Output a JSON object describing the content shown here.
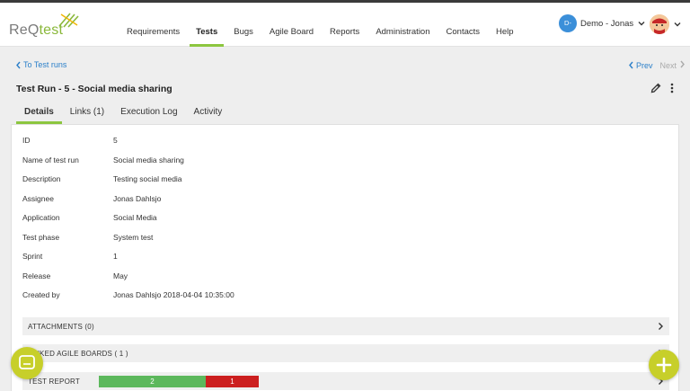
{
  "app": {
    "logo_main": "ReQ",
    "logo_accent": "test"
  },
  "nav": [
    {
      "label": "Requirements",
      "active": false
    },
    {
      "label": "Tests",
      "active": true
    },
    {
      "label": "Bugs",
      "active": false
    },
    {
      "label": "Agile Board",
      "active": false
    },
    {
      "label": "Reports",
      "active": false
    },
    {
      "label": "Administration",
      "active": false
    },
    {
      "label": "Contacts",
      "active": false
    },
    {
      "label": "Help",
      "active": false
    }
  ],
  "user": {
    "initials": "D-",
    "name": "Demo - Jonas"
  },
  "breadcrumb": {
    "back": "To Test runs",
    "prev": "Prev",
    "next": "Next"
  },
  "page": {
    "title": "Test Run - 5 - Social media sharing"
  },
  "tabs": [
    {
      "label": "Details",
      "active": true
    },
    {
      "label": "Links (1)",
      "active": false
    },
    {
      "label": "Execution Log",
      "active": false
    },
    {
      "label": "Activity",
      "active": false
    }
  ],
  "fields": [
    {
      "label": "ID",
      "value": "5"
    },
    {
      "label": "Name of test run",
      "value": "Social media sharing"
    },
    {
      "label": "Description",
      "value": "Testing social media"
    },
    {
      "label": "Assignee",
      "value": "Jonas Dahlsjo"
    },
    {
      "label": "Application",
      "value": "Social Media"
    },
    {
      "label": "Test phase",
      "value": "System test"
    },
    {
      "label": "Sprint",
      "value": "1"
    },
    {
      "label": "Release",
      "value": "May"
    },
    {
      "label": "Created by",
      "value": "Jonas Dahlsjo  2018-04-04 10:35:00"
    }
  ],
  "sections": {
    "attachments": "ATTACHMENTS (0)",
    "agile_boards": "LINKED AGILE BOARDS ( 1 )",
    "test_report": "TEST REPORT"
  },
  "test_report": {
    "passed": "2",
    "failed": "1",
    "passed_color": "#5cb85c",
    "failed_color": "#cc1f1f"
  },
  "colors": {
    "accent": "#8cc63f",
    "link": "#2a7fc9",
    "fab": "#c7cf2a"
  },
  "icons": {
    "chat": "chat-bubble-icon",
    "add": "plus-icon",
    "edit": "pencil-icon",
    "more": "kebab-menu-icon"
  }
}
